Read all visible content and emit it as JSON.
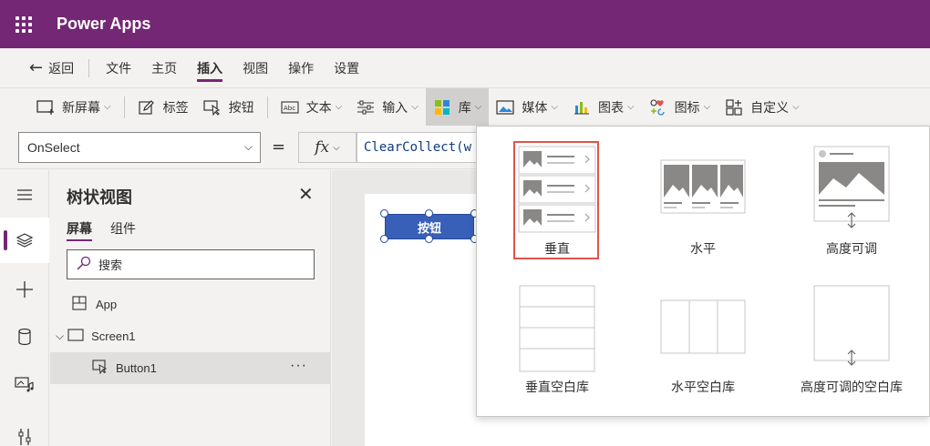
{
  "app": {
    "title": "Power Apps"
  },
  "menu": {
    "back": "返回",
    "items": [
      "文件",
      "主页",
      "插入",
      "视图",
      "操作",
      "设置"
    ],
    "active": "插入"
  },
  "ribbon": {
    "new_screen": "新屏幕",
    "label": "标签",
    "button": "按钮",
    "text": "文本",
    "input": "输入",
    "gallery": "库",
    "media": "媒体",
    "charts": "图表",
    "icons": "图标",
    "custom": "自定义"
  },
  "formula_bar": {
    "property": "OnSelect",
    "equals": "=",
    "fx": "fx",
    "formula": "ClearCollect(w"
  },
  "tree": {
    "title": "树状视图",
    "tabs": [
      "屏幕",
      "组件"
    ],
    "search_placeholder": "搜索",
    "nodes": [
      {
        "name": "App"
      },
      {
        "name": "Screen1"
      },
      {
        "name": "Button1"
      }
    ],
    "more": "···"
  },
  "canvas": {
    "button_text": "按钮"
  },
  "gallery_menu": {
    "items": [
      {
        "label": "垂直",
        "selected": true
      },
      {
        "label": "水平",
        "selected": false
      },
      {
        "label": "高度可调",
        "selected": false
      },
      {
        "label": "垂直空白库",
        "selected": false
      },
      {
        "label": "水平空白库",
        "selected": false
      },
      {
        "label": "高度可调的空白库",
        "selected": false
      }
    ]
  },
  "colors": {
    "brand": "#742774",
    "highlight": "#e0544c",
    "button": "#3860b8"
  }
}
